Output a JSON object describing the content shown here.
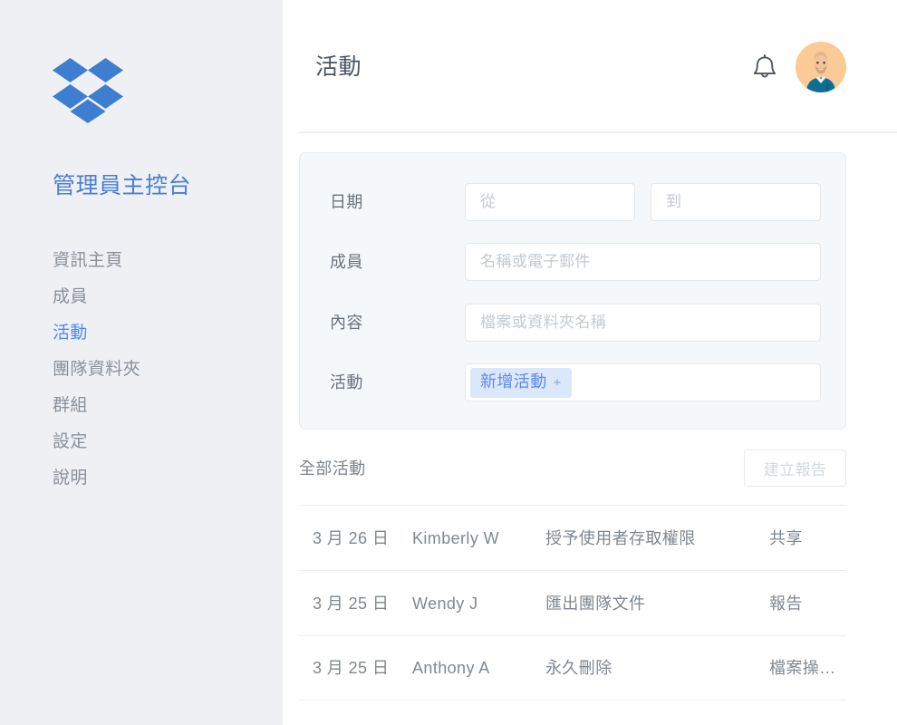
{
  "sidebar": {
    "logo_icon": "dropbox-logo-icon",
    "title": "管理員主控台",
    "items": [
      {
        "label": "資訊主頁",
        "active": false
      },
      {
        "label": "成員",
        "active": false
      },
      {
        "label": "活動",
        "active": true
      },
      {
        "label": "團隊資料夾",
        "active": false
      },
      {
        "label": "群組",
        "active": false
      },
      {
        "label": "設定",
        "active": false
      },
      {
        "label": "說明",
        "active": false
      }
    ]
  },
  "header": {
    "title": "活動",
    "bell_icon": "notification-bell-icon",
    "avatar_icon": "user-avatar-icon"
  },
  "filters": {
    "date": {
      "label": "日期",
      "from_placeholder": "從",
      "from_value": "",
      "to_placeholder": "到",
      "to_value": ""
    },
    "member": {
      "label": "成員",
      "placeholder": "名稱或電子郵件",
      "value": ""
    },
    "content": {
      "label": "內容",
      "placeholder": "檔案或資料夾名稱",
      "value": ""
    },
    "activity": {
      "label": "活動",
      "chip_label": "新增活動",
      "chip_plus": "+"
    }
  },
  "list": {
    "title": "全部活動",
    "create_report_label": "建立報告",
    "rows": [
      {
        "date": "3 月 26 日",
        "member": "Kimberly W",
        "action": "授予使用者存取權限",
        "type": "共享"
      },
      {
        "date": "3 月 25 日",
        "member": "Wendy J",
        "action": "匯出團隊文件",
        "type": "報告"
      },
      {
        "date": "3 月 25 日",
        "member": "Anthony A",
        "action": "永久刪除",
        "type": "檔案操…"
      }
    ]
  },
  "colors": {
    "brand_blue": "#3d7ed1",
    "accent_blue": "#4a8af4",
    "title_blue": "#4a7fd4",
    "sidebar_bg": "#eef0f4",
    "panel_bg": "#f5f8fa",
    "chip_bg": "#dbe8fb",
    "chip_text": "#5e8ae8",
    "avatar_bg": "#fbcb96"
  }
}
